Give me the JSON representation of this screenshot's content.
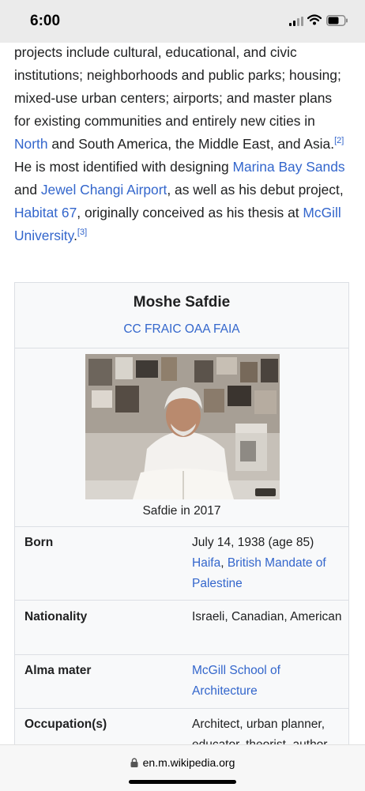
{
  "status_bar": {
    "time": "6:00"
  },
  "article": {
    "t1": "projects include cultural, educational, and civic institutions; neighborhoods and public parks; housing; mixed-use urban centers; airports; and master plans for existing communities and entirely new cities in ",
    "l_north": "North",
    "t2": " and South America, the Middle East, and Asia.",
    "ref2": "[2]",
    "t3": " He is most identified with designing ",
    "l_marina": "Marina Bay Sands",
    "t4": " and ",
    "l_jewel": "Jewel Changi Airport",
    "t5": ", as well as his debut project, ",
    "l_habitat": "Habitat 67",
    "t6": ", originally conceived as his thesis at ",
    "l_mcgill": "McGill University",
    "t7": ".",
    "ref3": "[3]"
  },
  "infobox": {
    "name": "Moshe Safdie",
    "postnominals": "CC FRAIC OAA FAIA",
    "caption": "Safdie in 2017",
    "born_label": "Born",
    "born_date": "July 14, 1938 (age 85)",
    "born_city": "Haifa",
    "born_sep": ", ",
    "born_country": "British Mandate of Palestine",
    "nationality_label": "Nationality",
    "nationality_value": "Israeli, Canadian, American",
    "alma_label": "Alma mater",
    "alma_value": "McGill School of Architecture",
    "occupation_label": "Occupation(s)",
    "occupation_value": "Architect, urban planner, educator, theorist, author"
  },
  "browser": {
    "url": "en.m.wikipedia.org"
  }
}
